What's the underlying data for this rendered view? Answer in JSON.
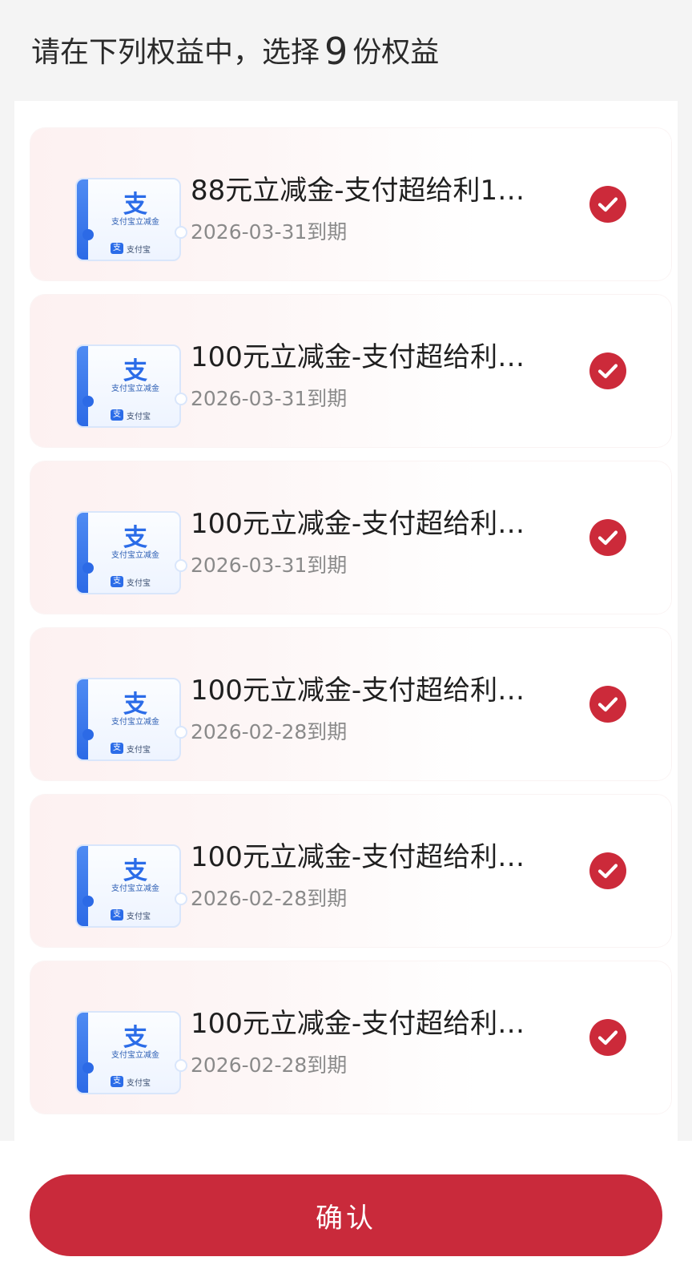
{
  "header": {
    "prefix": "请在下列权益中，选择",
    "count": "9",
    "suffix": "份权益"
  },
  "ticket": {
    "icon_char": "支",
    "caption": "支付宝立减金",
    "brand_mark": "支",
    "brand_text": "支付宝"
  },
  "items": [
    {
      "title": "88元立减金-支付超给利1…",
      "expiry": "2026-03-31到期",
      "selected": true
    },
    {
      "title": "100元立减金-支付超给利…",
      "expiry": "2026-03-31到期",
      "selected": true
    },
    {
      "title": "100元立减金-支付超给利…",
      "expiry": "2026-03-31到期",
      "selected": true
    },
    {
      "title": "100元立减金-支付超给利…",
      "expiry": "2026-02-28到期",
      "selected": true
    },
    {
      "title": "100元立减金-支付超给利…",
      "expiry": "2026-02-28到期",
      "selected": true
    },
    {
      "title": "100元立减金-支付超给利…",
      "expiry": "2026-02-28到期",
      "selected": true
    }
  ],
  "confirm_label": "确认",
  "colors": {
    "accent": "#c92a3b",
    "ticket_blue": "#2b6ce8"
  }
}
